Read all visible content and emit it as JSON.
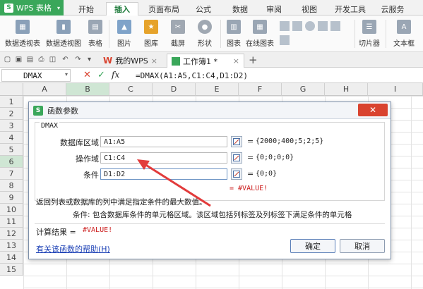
{
  "app": {
    "name": "WPS 表格",
    "logo": "S"
  },
  "menu": {
    "tabs": [
      "开始",
      "插入",
      "页面布局",
      "公式",
      "数据",
      "审阅",
      "视图",
      "开发工具",
      "云服务"
    ],
    "active": "插入"
  },
  "ribbon": {
    "items": [
      "数据透视表",
      "数据透视图",
      "表格",
      "图片",
      "图库",
      "截屏",
      "形状",
      "图表",
      "在线图表",
      "切片器",
      "文本框"
    ]
  },
  "tabs": {
    "home": "我的WPS",
    "doc": "工作簿1 *",
    "add": "+"
  },
  "formula_bar": {
    "name_box": "DMAX",
    "cancel": "✕",
    "confirm": "✓",
    "fx": "fx",
    "formula": "=DMAX(A1:A5,C1:C4,D1:D2)"
  },
  "grid": {
    "columns": [
      "A",
      "B",
      "C",
      "D",
      "E",
      "F",
      "G",
      "H",
      "I"
    ],
    "active_column": "B",
    "rows": [
      "1",
      "2",
      "3",
      "4",
      "5",
      "6",
      "7",
      "8",
      "9",
      "10",
      "11",
      "12",
      "13",
      "14",
      "15"
    ],
    "active_row": "6"
  },
  "dialog": {
    "title": "函数参数",
    "function_name": "DMAX",
    "params": [
      {
        "label": "数据库区域",
        "value": "A1:A5",
        "result": "{2000;400;5;2;5}"
      },
      {
        "label": "操作域",
        "value": "C1:C4",
        "result": "{0;0;0;0}"
      },
      {
        "label": "条件",
        "value": "D1:D2",
        "result": "{0;0}"
      }
    ],
    "eq": "=",
    "formula_result": "= #VALUE!",
    "description": "返回列表或数据库的列中满足指定条件的最大数值。",
    "arg_description": "条件:  包含数据库条件的单元格区域。该区域包括列标签及列标签下满足条件的单元格",
    "calc_label": "计算结果 =",
    "calc_value": "#VALUE!",
    "help_link": "有关该函数的帮助(H)",
    "ok": "确定",
    "cancel": "取消"
  },
  "colors": {
    "brand": "#3aa75a",
    "error": "#cc1f1f",
    "arrow": "#e23b3b",
    "link": "#1a3fb5"
  }
}
